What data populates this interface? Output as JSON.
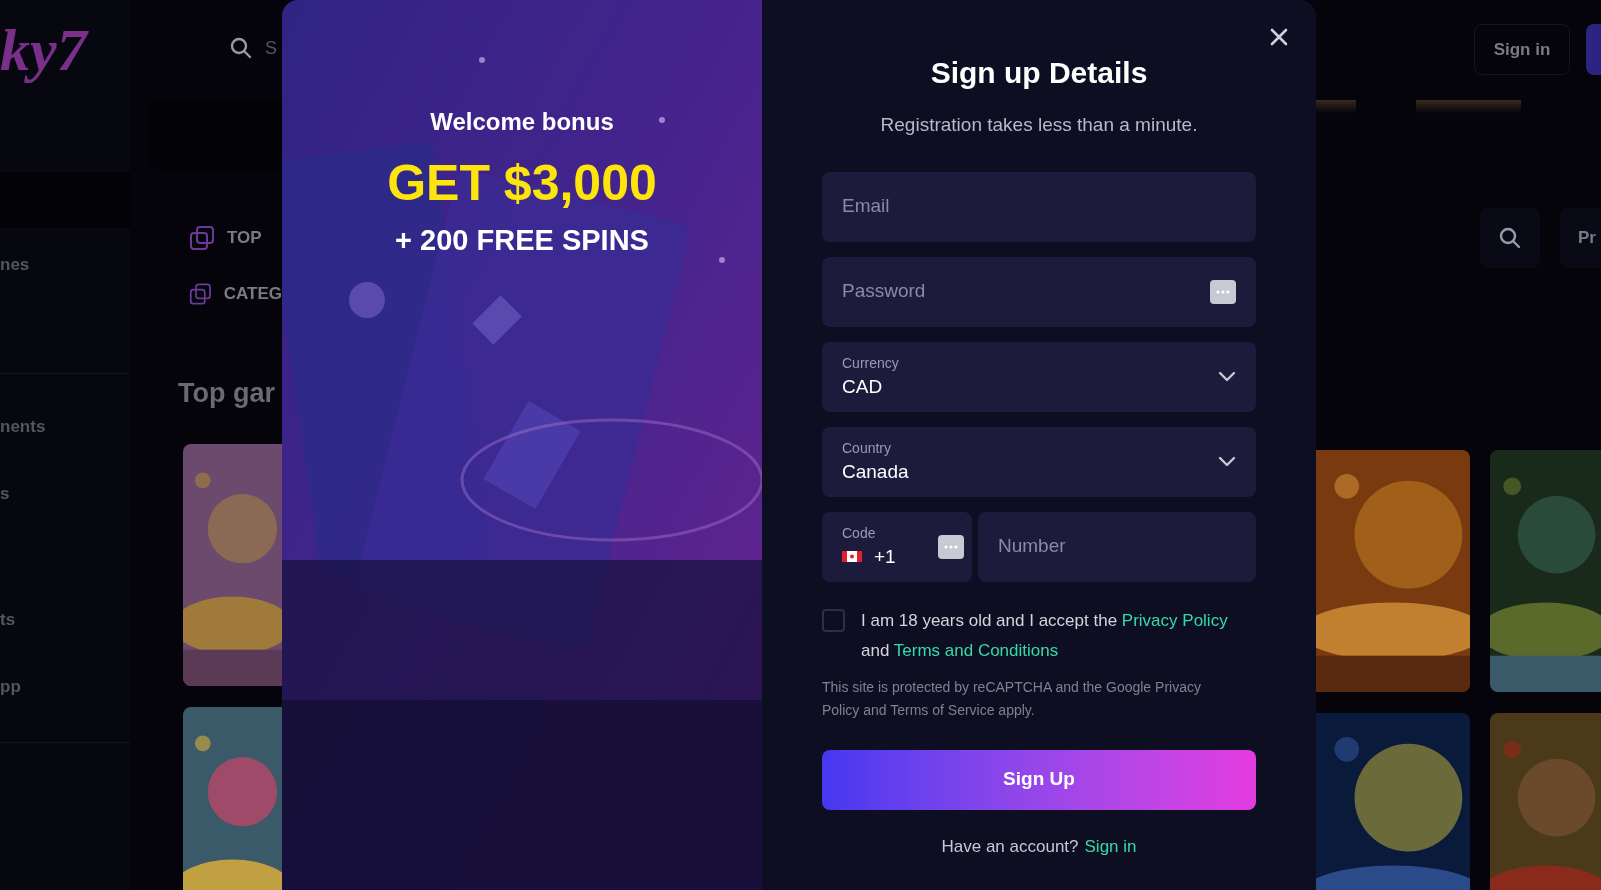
{
  "background": {
    "logo": "ky7",
    "search_placeholder": "S",
    "sidebar_items": [
      "nes",
      "nents",
      "s",
      "ts",
      "pp"
    ],
    "nav": [
      {
        "label": "TOP"
      },
      {
        "label": "CATEG"
      }
    ],
    "section_title": "Top gar",
    "sign_in": "Sign in",
    "filter_button": "Pr"
  },
  "modal": {
    "bonus": {
      "title": "Welcome bonus",
      "amount": "GET $3,000",
      "extra": "+ 200 FREE SPINS"
    },
    "title": "Sign up Details",
    "subtitle": "Registration takes less than a minute.",
    "fields": [
      {
        "kind": "text",
        "placeholder": "Email"
      },
      {
        "kind": "password",
        "placeholder": "Password"
      },
      {
        "kind": "select",
        "label": "Currency",
        "value": "CAD"
      },
      {
        "kind": "select",
        "label": "Country",
        "value": "Canada"
      }
    ],
    "phone": {
      "code_label": "Code",
      "code": "+1",
      "number_placeholder": "Number"
    },
    "consent": {
      "checked": false,
      "text": "I am 18 years old and I accept the",
      "link1": "Privacy Policy",
      "middle": "and",
      "link2": "Terms and Conditions"
    },
    "recaptcha": "This site is protected by reCAPTCHA and the Google Privacy Policy and Terms of Service apply.",
    "submit": "Sign Up",
    "footer": {
      "text": "Have an account?",
      "link": "Sign in"
    }
  }
}
